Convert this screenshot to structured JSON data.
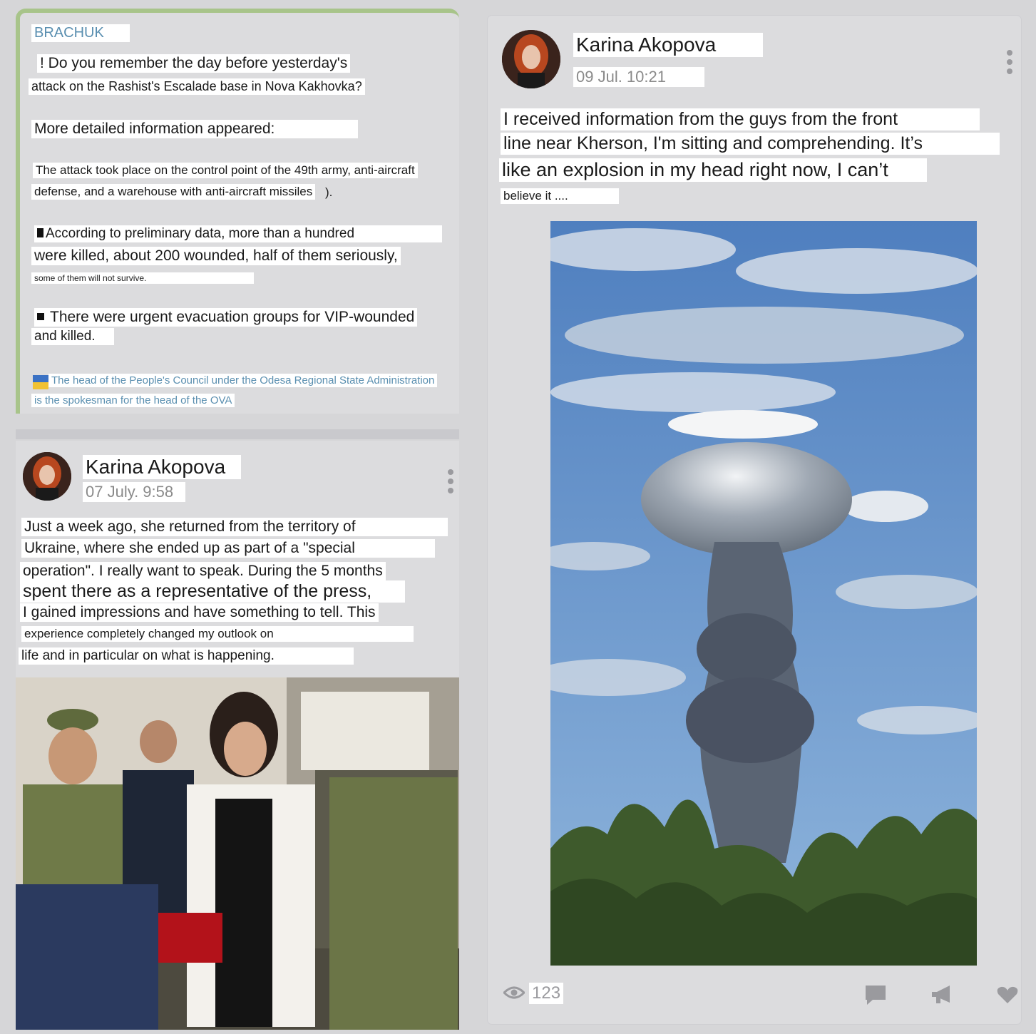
{
  "card_tg": {
    "channel": "BRACHUK",
    "line1": "! Do you remember the day before yesterday's",
    "line2": "attack on the Rashist's Escalade base in Nova Kakhovka?",
    "line3": "More detailed information appeared:",
    "line4": "The attack took place on the control point of the 49th army, anti-aircraft",
    "line5": "defense, and a warehouse with anti-aircraft missiles",
    "line5_tail": ").",
    "line6": "According to preliminary data, more than a hundred",
    "line7": "were killed, about 200 wounded, half of them seriously,",
    "line8": "some of them will not survive.",
    "line9": "There were urgent evacuation groups for VIP-wounded",
    "line10": "and killed.",
    "link1": "The head of the People's Council under the Odesa Regional State Administration",
    "link2": "is the spokesman for the head of the OVA",
    "link_color": "#5a8fb0"
  },
  "post2": {
    "author": "Karina Akopova",
    "date": "07 July. 9:58",
    "lines": [
      "Just a week ago, she returned from the territory of",
      "Ukraine, where she ended up as part of a \"special",
      "operation\". I really want to speak. During the 5 months",
      "spent there as a representative of the press,",
      "I gained impressions and have something to tell. This",
      "experience completely changed my outlook on",
      "life and in particular on what is happening."
    ],
    "photo_icon": "award-ceremony-photo"
  },
  "post1": {
    "author": "Karina Akopova",
    "date": "09 Jul. 10:21",
    "lines": [
      "I received information from the guys from the front",
      "line near Kherson, I'm sitting and comprehending. It’s",
      "like an explosion in my head right now, I can’t",
      "believe it ...."
    ],
    "photo_icon": "mushroom-cloud-photo",
    "views": "123"
  }
}
